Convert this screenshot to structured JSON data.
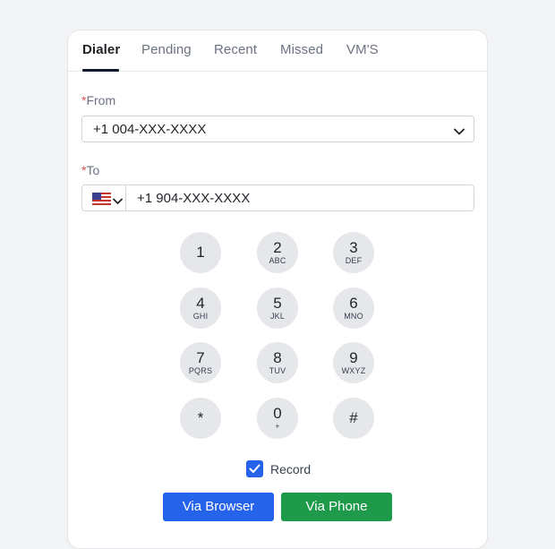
{
  "tabs": [
    {
      "label": "Dialer",
      "active": true
    },
    {
      "label": "Pending",
      "active": false
    },
    {
      "label": "Recent",
      "active": false
    },
    {
      "label": "Missed",
      "active": false
    },
    {
      "label": "VM'S",
      "active": false
    }
  ],
  "from": {
    "required_mark": "*",
    "label": "From",
    "value": "+1 004-XXX-XXXX",
    "icon": "chevron-down-icon"
  },
  "to": {
    "required_mark": "*",
    "label": "To",
    "country_flag": "us-flag-icon",
    "value": "+1 904-XXX-XXXX"
  },
  "keypad": [
    {
      "digit": "1",
      "letters": ""
    },
    {
      "digit": "2",
      "letters": "ABC"
    },
    {
      "digit": "3",
      "letters": "DEF"
    },
    {
      "digit": "4",
      "letters": "GHI"
    },
    {
      "digit": "5",
      "letters": "JKL"
    },
    {
      "digit": "6",
      "letters": "MNO"
    },
    {
      "digit": "7",
      "letters": "PQRS"
    },
    {
      "digit": "8",
      "letters": "TUV"
    },
    {
      "digit": "9",
      "letters": "WXYZ"
    },
    {
      "digit": "*",
      "letters": ""
    },
    {
      "digit": "0",
      "letters": "+"
    },
    {
      "digit": "#",
      "letters": ""
    }
  ],
  "record": {
    "label": "Record",
    "checked": true
  },
  "buttons": {
    "via_browser": "Via Browser",
    "via_phone": "Via Phone"
  },
  "colors": {
    "primary_blue": "#2563eb",
    "primary_green": "#1f9a4b",
    "required_red": "#d9534f",
    "key_bg": "#e6e7ea"
  }
}
